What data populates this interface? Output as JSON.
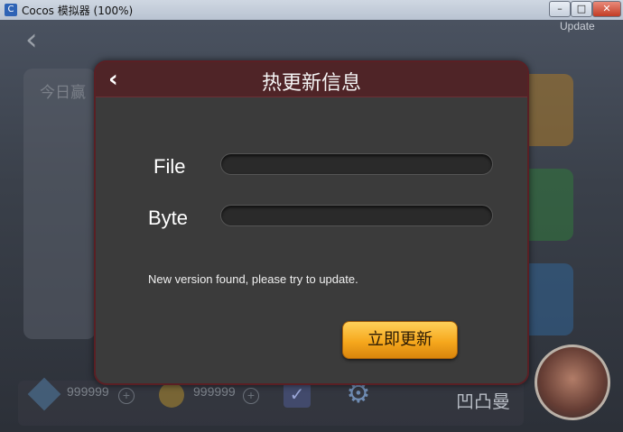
{
  "window": {
    "title": "Cocos 模拟器 (100%)",
    "minimize_label": "–",
    "maximize_label": "□",
    "close_label": "✕"
  },
  "background": {
    "update_label": "Update",
    "today_label": "今日赢",
    "diamonds": "999999",
    "coins": "999999",
    "player_name": "凹凸曼",
    "plus": "+"
  },
  "dialog": {
    "title": "热更新信息",
    "back_icon": "‹",
    "file_label": "File",
    "byte_label": "Byte",
    "file_progress": 0,
    "byte_progress": 0,
    "message": "New version found, please try to update.",
    "update_button": "立即更新"
  }
}
